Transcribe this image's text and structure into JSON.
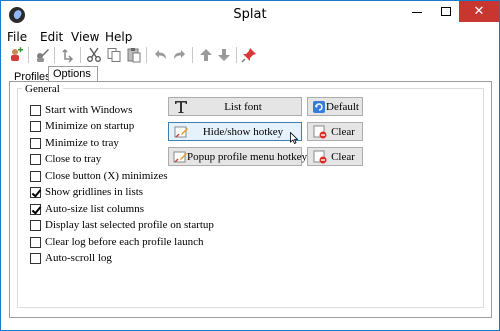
{
  "window": {
    "title": "Splat",
    "controls": {
      "minimize": "minimize",
      "maximize": "maximize",
      "close": "✕"
    },
    "close_color": "#c7372f",
    "border_color": "#1979ca"
  },
  "menubar": {
    "items": [
      {
        "label": "File"
      },
      {
        "label": "Edit"
      },
      {
        "label": "View"
      },
      {
        "label": "Help"
      }
    ]
  },
  "toolbar": {
    "buttons": [
      {
        "icon": "add-profile-icon"
      },
      {
        "icon": "edit-profile-icon"
      },
      {
        "icon": "duplicate-profile-icon"
      },
      {
        "icon": "cut-icon"
      },
      {
        "icon": "copy-icon"
      },
      {
        "icon": "paste-icon"
      },
      {
        "icon": "undo-icon"
      },
      {
        "icon": "redo-icon"
      },
      {
        "icon": "move-up-icon"
      },
      {
        "icon": "move-down-icon"
      },
      {
        "icon": "pin-icon"
      }
    ]
  },
  "tabs": [
    {
      "label": "Profiles",
      "active": false
    },
    {
      "label": "Options",
      "active": true
    }
  ],
  "general": {
    "legend": "General",
    "checkboxes": [
      {
        "label": "Start with Windows",
        "checked": false
      },
      {
        "label": "Minimize on startup",
        "checked": false
      },
      {
        "label": "Minimize to tray",
        "checked": false
      },
      {
        "label": "Close to tray",
        "checked": false
      },
      {
        "label": "Close button (X) minimizes",
        "checked": false
      },
      {
        "label": "Show gridlines in lists",
        "checked": true
      },
      {
        "label": "Auto-size list columns",
        "checked": true
      },
      {
        "label": "Display last selected profile on startup",
        "checked": false
      },
      {
        "label": "Clear log before each profile launch",
        "checked": false
      },
      {
        "label": "Auto-scroll log",
        "checked": false
      }
    ],
    "buttons": {
      "list_font": "List font",
      "default": "Default",
      "hide_show_hotkey": "Hide/show hotkey",
      "clear1": "Clear",
      "popup_hotkey": "Popup profile menu hotkey",
      "clear2": "Clear"
    }
  }
}
